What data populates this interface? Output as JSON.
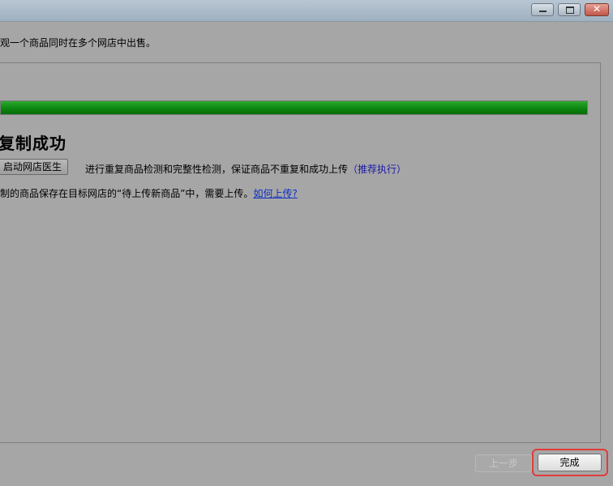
{
  "window": {
    "controls": [
      "minimize-icon",
      "maximize-icon",
      "close-icon"
    ]
  },
  "description": "观一个商品同时在多个网店中出售。",
  "progress": {
    "percent": 100,
    "color": "#0f8a12"
  },
  "status": {
    "title": "复制成功"
  },
  "doctor": {
    "button_label": "启动网店医生",
    "hint": "进行重复商品检测和完整性检测，保证商品不重复和成功上传",
    "recommend": "（推荐执行）"
  },
  "info": {
    "text": "制的商品保存在目标网店的“待上传新商品”中，需要上传。",
    "link": "如何上传?"
  },
  "footer": {
    "prev_label": "上一步",
    "finish_label": "完成",
    "highlight_color": "#e23b3b"
  }
}
